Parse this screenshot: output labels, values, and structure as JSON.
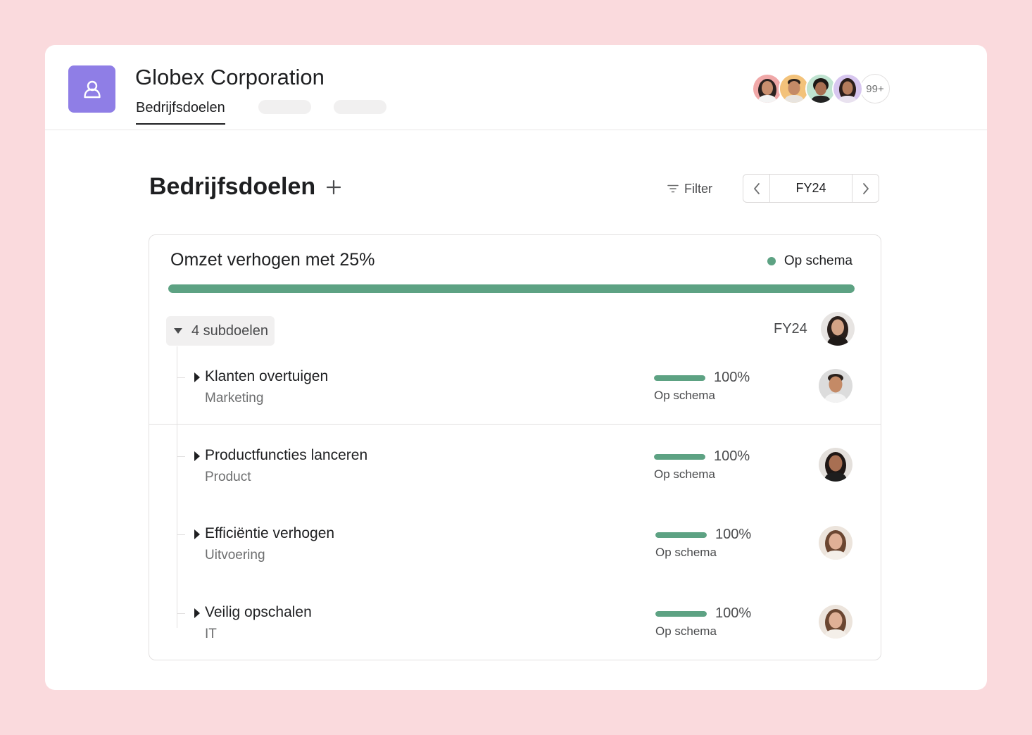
{
  "colors": {
    "background": "#fadadd",
    "accent_purple": "#8f7ee6",
    "on_track_green": "#5da283"
  },
  "header": {
    "workspace_icon": "team-people-icon",
    "workspace_name": "Globex Corporation",
    "active_tab": "Bedrijfsdoelen",
    "member_overflow_label": "99+"
  },
  "page": {
    "title": "Bedrijfsdoelen",
    "add_icon": "plus-icon",
    "filter_label": "Filter",
    "filter_icon": "filter-icon",
    "period": "FY24",
    "prev_icon": "chevron-left-icon",
    "next_icon": "chevron-right-icon"
  },
  "goal": {
    "title": "Omzet verhogen met 25%",
    "status": "Op schema",
    "progress": 1.0,
    "subgoals_label": "4 subdoelen",
    "period": "FY24",
    "subgoals": [
      {
        "name": "Klanten overtuigen",
        "team": "Marketing",
        "percent": "100%",
        "progress": 1.0,
        "status": "Op schema"
      },
      {
        "name": "Productfuncties lanceren",
        "team": "Product",
        "percent": "100%",
        "progress": 1.0,
        "status": "Op schema"
      },
      {
        "name": "Efficiëntie verhogen",
        "team": "Uitvoering",
        "percent": "100%",
        "progress": 1.0,
        "status": "Op schema"
      },
      {
        "name": "Veilig opschalen",
        "team": "IT",
        "percent": "100%",
        "progress": 1.0,
        "status": "Op schema"
      }
    ]
  }
}
